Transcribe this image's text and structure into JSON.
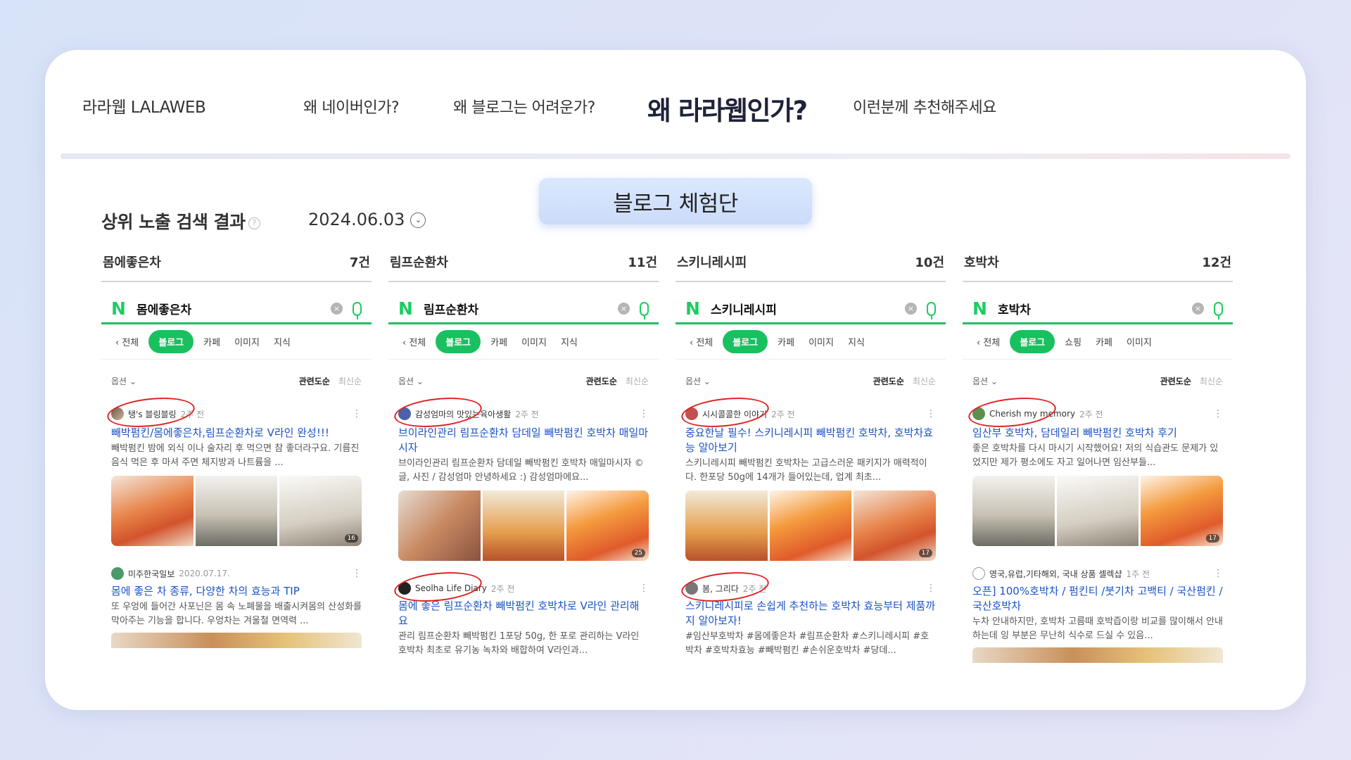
{
  "nav": {
    "brand": "라라웹 LALAWEB",
    "items": [
      "왜 네이버인가?",
      "왜 블로그는 어려운가?",
      "왜 라라웹인가?",
      "이런분께 추천해주세요"
    ],
    "active_index": 2
  },
  "badge": "블로그 체험단",
  "result": {
    "title": "상위 노출 검색 결과",
    "help": "?",
    "date": "2024.06.03"
  },
  "columns": [
    {
      "keyword": "몸에좋은차",
      "count": "7건",
      "query": "몸에좋은차",
      "tabs": [
        "전체",
        "블로그",
        "카페",
        "이미지",
        "지식"
      ],
      "options": {
        "label": "옵션",
        "sort_on": "관련도순",
        "sort_off": "최신순"
      },
      "post1": {
        "author": "탱's 블링블링",
        "ago": "2주 전",
        "title": "빼박펌킨/몸에좋은차,림프순환차로 V라인 완성!!!",
        "desc": "빼박펌킨 밤에 외식 이나 술자리 후 먹으면 참 좋더라구요. 기름진 음식 먹은 후 마셔 주면 체지방과 나트륨을 ...",
        "count": "16"
      },
      "post2": {
        "author": "미주한국일보",
        "ago": "2020.07.17.",
        "title": "몸에 좋은 차 종류, 다양한 차의 효능과 TIP",
        "desc": "또 우엉에 들어간 사포닌은 몸 속 노폐물을 배출시켜몸의 산성화를 막아주는 기능을 합니다. 우엉차는 겨울철 면역력 ..."
      }
    },
    {
      "keyword": "림프순환차",
      "count": "11건",
      "query": "림프순환차",
      "tabs": [
        "전체",
        "블로그",
        "카페",
        "이미지",
        "지식"
      ],
      "options": {
        "label": "옵션",
        "sort_on": "관련도순",
        "sort_off": "최신순"
      },
      "post1": {
        "author": "감성엄마의 맛있는육아생활",
        "ago": "2주 전",
        "title": "브이라인관리 림프순환차 담데일 빼박펌킨 호박차 매일마시자",
        "desc": "브이라인관리 림프순환차 담데일 빼박펌킨 호박차 매일마시자 © 글, 사진 / 감성엄마 안녕하세요 :) 감성엄마에요...",
        "count": "25"
      },
      "post2": {
        "author": "Seolha Life Diary",
        "ago": "2주 전",
        "title": "몸에 좋은 림프순환차 빼박펌킨 호박차로 V라인 관리해요",
        "desc": "관리 림프순환차 빼박펌킨 1포당 50g, 한 포로 관리하는 V라인 호박차 최초로 유기농 녹차와 배합하여 V라인과..."
      }
    },
    {
      "keyword": "스키니레시피",
      "count": "10건",
      "query": "스키니레시피",
      "tabs": [
        "전체",
        "블로그",
        "카페",
        "이미지",
        "지식"
      ],
      "options": {
        "label": "옵션",
        "sort_on": "관련도순",
        "sort_off": "최신순"
      },
      "post1": {
        "author": "시시콜콜한 이야기",
        "ago": "2주 전",
        "title": "중요한날 필수! 스키니레시피 빼박펌킨 호박차, 호박차효능 알아보기",
        "desc": "스키니레시피 빼박펌킨 호박차는 고급스러운 패키지가 매력적이다. 한포당 50g에 14개가 들어있는데, 업계 최초...",
        "count": "17"
      },
      "post2": {
        "author": "봄, 그리다",
        "ago": "2주 전",
        "title": "스키니레시피로 손쉽게 추천하는 호박차 효능부터 제품까지 알아보자!",
        "desc": "#임산부호박차 #몸에좋은차 #림프순환차 #스키니레시피 #호박차 #호박차효능 #빼박펌킨 #손쉬운호박차 #당데..."
      }
    },
    {
      "keyword": "호박차",
      "count": "12건",
      "query": "호박차",
      "tabs": [
        "전체",
        "블로그",
        "쇼핑",
        "카페",
        "이미지"
      ],
      "options": {
        "label": "옵션",
        "sort_on": "관련도순",
        "sort_off": "최신순"
      },
      "post1": {
        "author": "Cherish my memory",
        "ago": "2주 전",
        "title": "임산부 호박차, 담데일리 빼박펌킨 호박차 후기",
        "desc": "좋은 호박차를 다시 마시기 시작했어요! 저의 식습관도 문제가 있었지만 제가 평소에도 자고 일어나면 임산부들...",
        "count": "17"
      },
      "post2": {
        "author": "영국,유럽,기타해외, 국내 상품 셀렉샵",
        "ago": "1주 전",
        "title": "오픈] 100%호박차 / 펌킨티 /붓기차 고백티 / 국산펌킨 / 국산호박차",
        "desc": "누차 안내하지만, 호박차 고름때 호박즙이랑 비교를 많이해서 안내하는데 잉 부분은 무난히 식수로 드실 수 있음..."
      }
    }
  ]
}
